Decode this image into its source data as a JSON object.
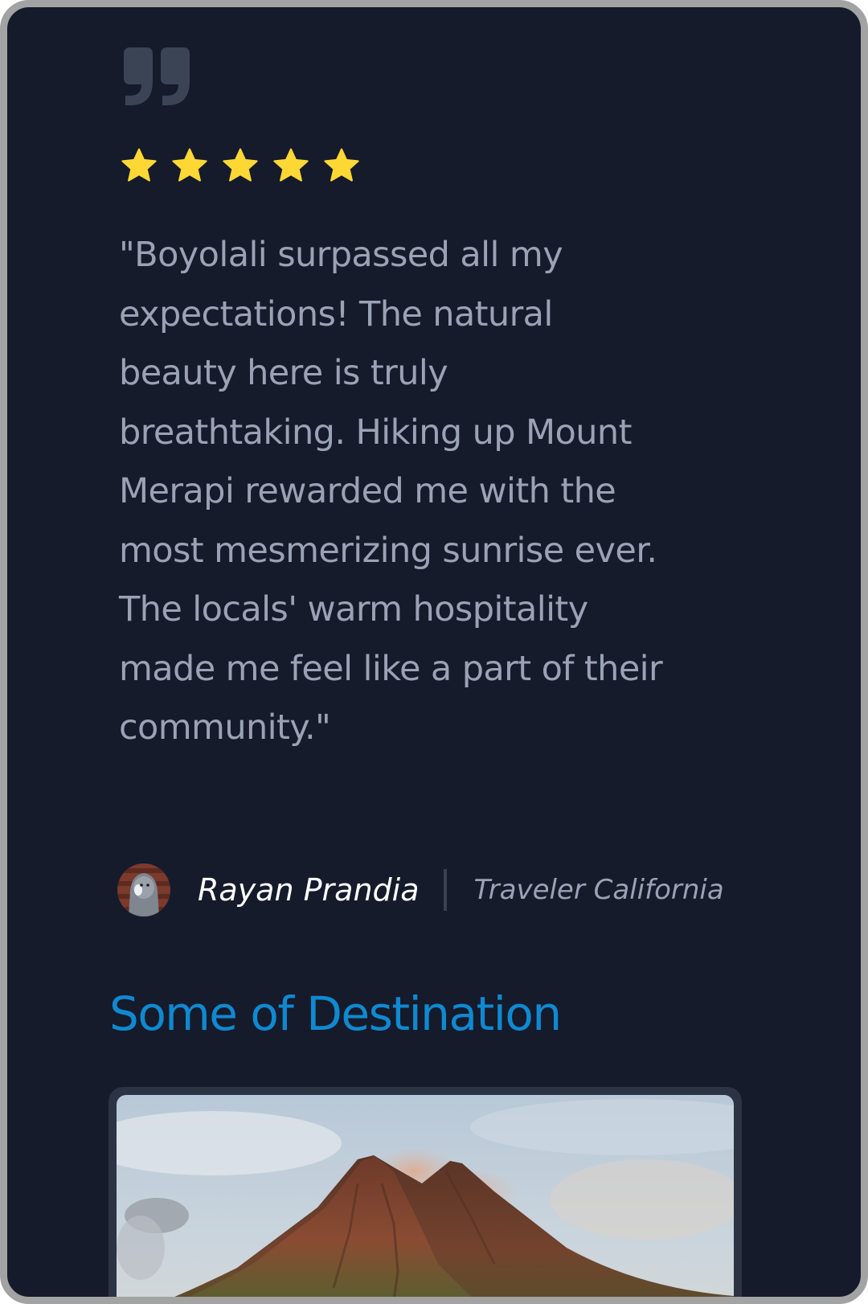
{
  "testimonial": {
    "quote_icon": "quote-icon",
    "rating": 5,
    "rating_max": 5,
    "star_icon": "star-icon",
    "star_color": "#fdd835",
    "text": "\"Boyolali surpassed all my expectations! The natural beauty here is truly breathtaking. Hiking up Mount Merapi rewarded me with the most mesmerizing sunrise ever. The locals' warm hospitality made me feel like a part of their community.\"",
    "author": {
      "name": "Rayan Prandia",
      "role": "Traveler California"
    }
  },
  "destinations": {
    "title": "Some of Destination",
    "title_color": "#1089d0",
    "items": [
      {
        "image_subject": "erupting volcano mountain at sunrise"
      }
    ]
  },
  "colors": {
    "background": "#151b2b",
    "text_muted": "#9aa2b4",
    "text_white": "#ffffff"
  }
}
